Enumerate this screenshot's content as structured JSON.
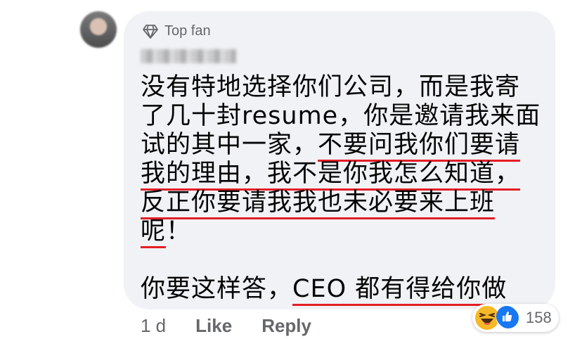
{
  "comment": {
    "badge": "Top fan",
    "lines": [
      {
        "plain": "没有特地选择你们公司，而是我寄",
        "underlined": ""
      },
      {
        "plain": "了几十封resume，你是邀请我来面",
        "underlined": ""
      },
      {
        "plain": "试的其中一家，",
        "underlined": "不要问我你们要请"
      },
      {
        "plain": "",
        "underlined": "我的理由，我不是你我怎么知道，"
      },
      {
        "plain": "",
        "underlined": "反正你要请我我也未必要来上班"
      },
      {
        "plain": "",
        "underlined": "呢",
        "after": "！"
      },
      {
        "plain": "你要这样答，",
        "underlined": "CEO 都有得给你做"
      }
    ]
  },
  "footer": {
    "time": "1 d",
    "like": "Like",
    "reply": "Reply"
  },
  "reactions": {
    "icons": [
      "haha-icon",
      "like-icon"
    ],
    "count": "158"
  },
  "colors": {
    "bubble": "#f0f2f5",
    "underline": "#e41e26",
    "meta": "#65676b",
    "like": "#1877f2",
    "haha": "#f7b928"
  }
}
